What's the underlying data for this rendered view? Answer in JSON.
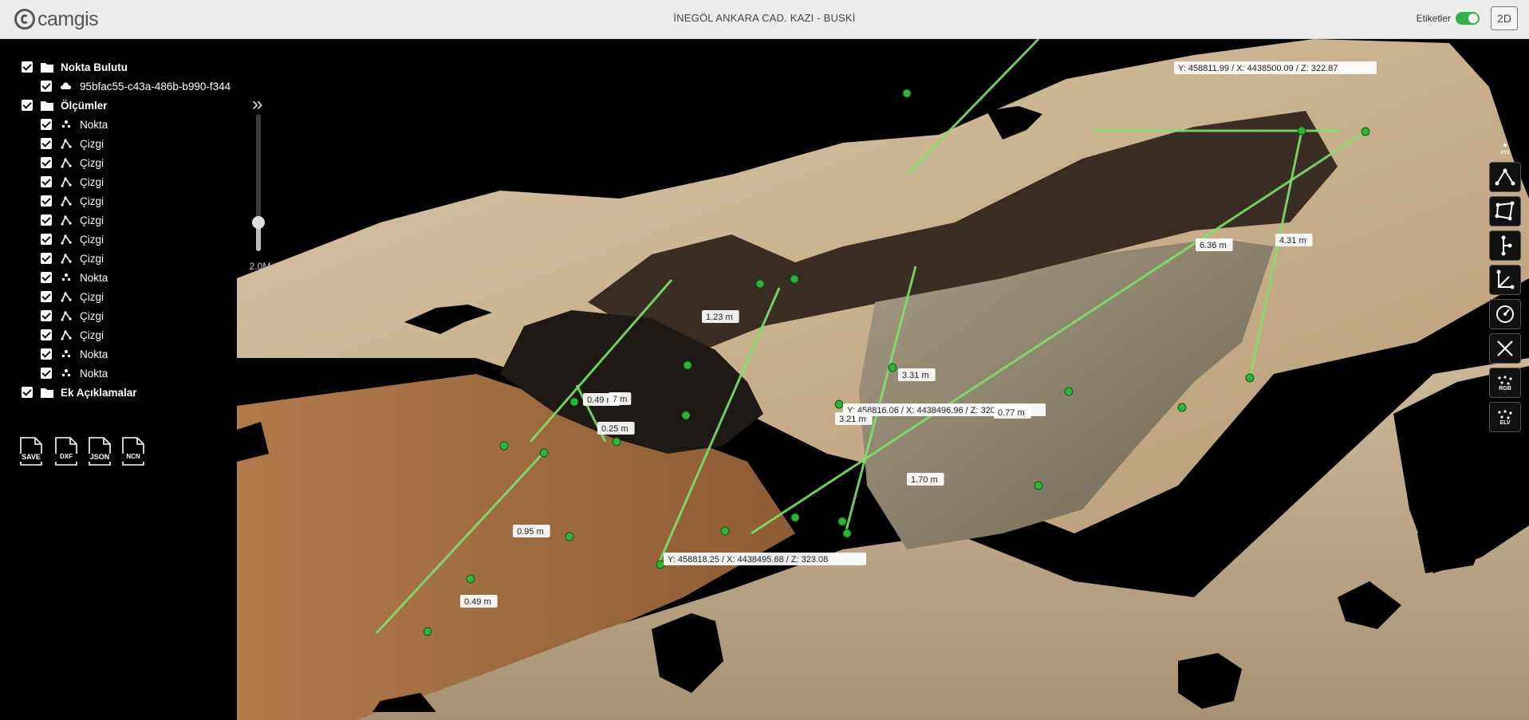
{
  "header": {
    "logo_text": "camgis",
    "title": "İNEGÖL ANKARA CAD. KAZI - BUSKİ",
    "labels_toggle_label": "Etiketler",
    "labels_toggle_on": true,
    "view_mode_button": "2D"
  },
  "sidebar": {
    "tree": [
      {
        "label": "Nokta Bulutu",
        "icon": "folder-icon",
        "level": 0,
        "checked": true
      },
      {
        "label": "95bfac55-c43a-486b-b990-f344",
        "icon": "cloud-icon",
        "level": 1,
        "checked": true
      },
      {
        "label": "Ölçümler",
        "icon": "folder-icon",
        "level": 0,
        "checked": true
      },
      {
        "label": "Nokta",
        "icon": "point-icon",
        "level": 1,
        "checked": true
      },
      {
        "label": "Çizgi",
        "icon": "line-icon",
        "level": 1,
        "checked": true
      },
      {
        "label": "Çizgi",
        "icon": "line-icon",
        "level": 1,
        "checked": true
      },
      {
        "label": "Çizgi",
        "icon": "line-icon",
        "level": 1,
        "checked": true
      },
      {
        "label": "Çizgi",
        "icon": "line-icon",
        "level": 1,
        "checked": true
      },
      {
        "label": "Çizgi",
        "icon": "line-icon",
        "level": 1,
        "checked": true
      },
      {
        "label": "Çizgi",
        "icon": "line-icon",
        "level": 1,
        "checked": true
      },
      {
        "label": "Çizgi",
        "icon": "line-icon",
        "level": 1,
        "checked": true
      },
      {
        "label": "Nokta",
        "icon": "point-icon",
        "level": 1,
        "checked": true
      },
      {
        "label": "Çizgi",
        "icon": "line-icon",
        "level": 1,
        "checked": true
      },
      {
        "label": "Çizgi",
        "icon": "line-icon",
        "level": 1,
        "checked": true
      },
      {
        "label": "Çizgi",
        "icon": "line-icon",
        "level": 1,
        "checked": true
      },
      {
        "label": "Nokta",
        "icon": "point-icon",
        "level": 1,
        "checked": true
      },
      {
        "label": "Nokta",
        "icon": "point-icon",
        "level": 1,
        "checked": true
      },
      {
        "label": "Ek Açıklamalar",
        "icon": "folder-icon",
        "level": 0,
        "checked": true
      }
    ],
    "point_size_value": "2.0M",
    "point_size_fraction": 0.18,
    "export_buttons": [
      "SAVE",
      "DXF",
      "JSON",
      "NCN"
    ]
  },
  "measurements": {
    "coordinate_labels": [
      "Y: 458811.99 / X: 4438500.09 / Z: 322.87",
      "Y: 458816.06 / X: 4438496.96 / Z: 320.77",
      "Y: 458818.25 / X: 4438495.68 / Z: 323.08"
    ],
    "distance_labels": [
      "6.36 m",
      "4.31 m",
      "1.23 m",
      "0.49 m",
      "7 m",
      "0.25 m",
      "3.31 m",
      "3.21 m",
      "0.77 m",
      "1.70 m",
      "0.95 m",
      "0.49 m"
    ]
  },
  "toolbar": {
    "xyz_label": "XYZ",
    "tools": [
      "angle-tool-icon",
      "area-tool-icon",
      "distance-tool-icon",
      "height-tool-icon",
      "circle-tool-icon",
      "clear-tool-icon"
    ],
    "rgb_label": "RGB",
    "elevation_label": "ELV"
  },
  "colors": {
    "accent": "#2fb344",
    "measure_line": "#7ee06a",
    "background": "#000000"
  }
}
